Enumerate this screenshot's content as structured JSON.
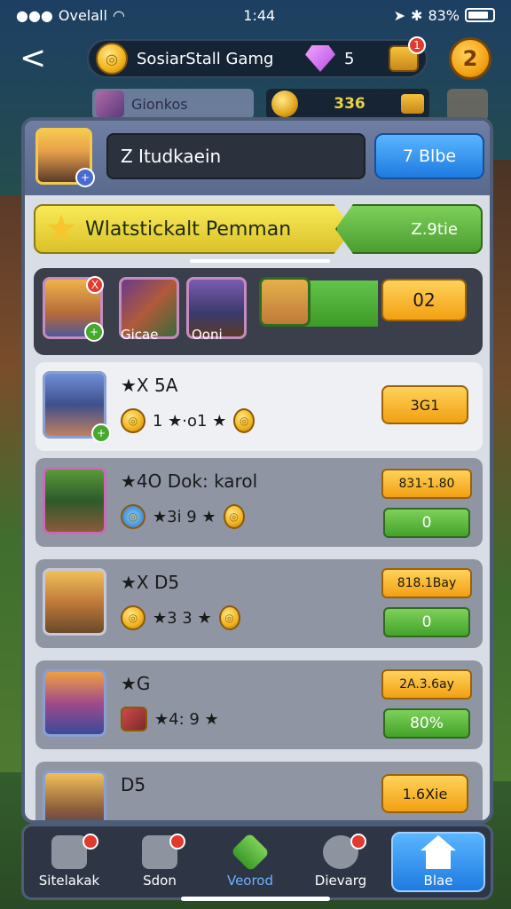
{
  "status_bar": {
    "carrier": "Ovelall",
    "time": "1:44",
    "battery": "83%"
  },
  "header": {
    "back_label": "<",
    "title": "SosiarStall Gamg",
    "gem_count": "5",
    "chest_badge": "1",
    "level": "2"
  },
  "subheader": {
    "player_name": "Gionkos",
    "currency_value": "336"
  },
  "panel": {
    "name_field": "Z Itudkaein",
    "blue_button": "7 Blbe",
    "banner_text": "Wlatstickalt Pemman",
    "banner_value": "Z.9tie"
  },
  "team": {
    "slot1_badge": "X",
    "label_1": "Gicae",
    "label_2": "Ooni",
    "score": "02"
  },
  "cards": [
    {
      "title": "★X 5A",
      "sub": "1 ★·o1 ★",
      "button": "3G1",
      "button_type": "gold"
    },
    {
      "title": "★4O Dok: karol",
      "sub": "★3i 9 ★",
      "price": "831-1.80",
      "button": "0",
      "button_type": "green"
    },
    {
      "title": "★X D5",
      "sub": "★3 3 ★",
      "price": "818.1Bay",
      "button": "0",
      "button_type": "green"
    },
    {
      "title": "★G",
      "sub": "★4: 9 ★",
      "price": "2A.3.6ay",
      "button": "80%",
      "button_type": "green"
    },
    {
      "title": "D5",
      "sub": "",
      "button": "1.6Xie",
      "button_type": "gold"
    }
  ],
  "bottom_nav": [
    {
      "label": "Sitelakak",
      "icon": "gear-icon",
      "badge": true
    },
    {
      "label": "Sdon",
      "icon": "shop-icon",
      "badge": true
    },
    {
      "label": "Veorod",
      "icon": "diamond-icon",
      "badge": false
    },
    {
      "label": "Dievarg",
      "icon": "camera-icon",
      "badge": true
    },
    {
      "label": "Blae",
      "icon": "home-icon",
      "badge": false
    }
  ],
  "colors": {
    "gold": "#f2a012",
    "green": "#43a32a",
    "blue": "#1e7ae0",
    "panel": "#d9dde5"
  }
}
